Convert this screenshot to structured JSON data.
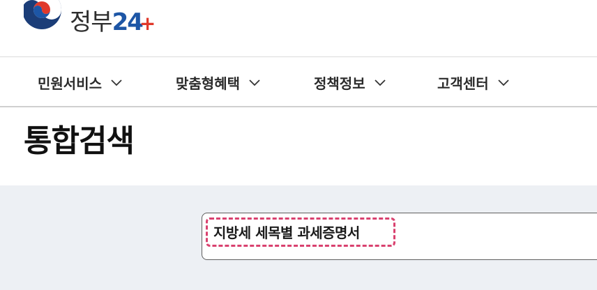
{
  "header": {
    "logo": {
      "text": "정부",
      "number": "24",
      "plus": "+",
      "colors": {
        "blue": "#1d56a6",
        "red": "#e0392b",
        "navy": "#1b3d78"
      }
    }
  },
  "gnb": {
    "items": [
      {
        "label": "민원서비스",
        "icon": "chevron-down-icon"
      },
      {
        "label": "맞춤형혜택",
        "icon": "chevron-down-icon"
      },
      {
        "label": "정책정보",
        "icon": "chevron-down-icon"
      },
      {
        "label": "고객센터",
        "icon": "chevron-down-icon"
      }
    ]
  },
  "page": {
    "title": "통합검색"
  },
  "search": {
    "value": "지방세 세목별 과세증명서",
    "highlight_color": "#d9416f"
  },
  "colors": {
    "search_area_bg": "#edf0f4",
    "divider": "#cfcfcf"
  }
}
